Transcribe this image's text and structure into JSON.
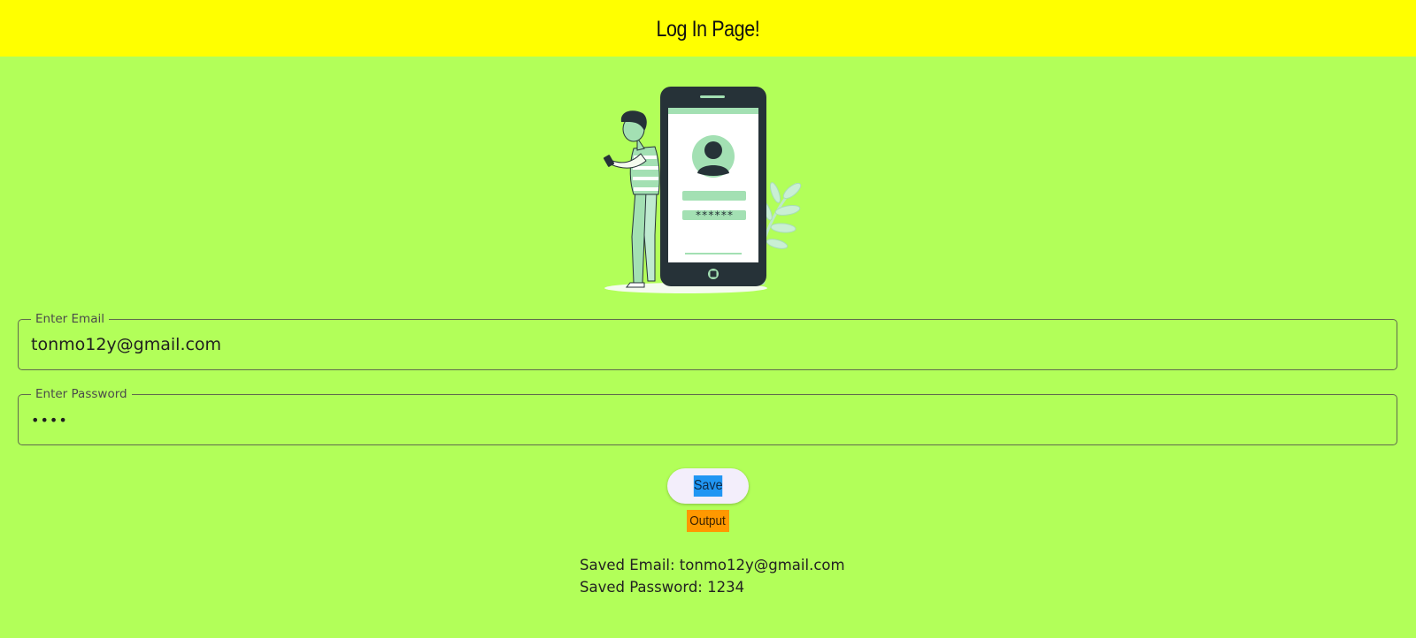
{
  "appbar": {
    "title": "Log In Page!",
    "background": "#ffff00"
  },
  "page": {
    "background": "#b2ff59"
  },
  "illustration": {
    "icon": "login-phone-illustration",
    "phone_password_mask": "******"
  },
  "form": {
    "email": {
      "label": "Enter Email",
      "value": "tonmo12y@gmail.com"
    },
    "password": {
      "label": "Enter Password",
      "value": "1234",
      "masked_value": "••••"
    }
  },
  "actions": {
    "save_label": "Save",
    "save_highlight": "#2196f3",
    "output_label": "Output",
    "output_color": "#ff9800"
  },
  "saved": {
    "email_line": "Saved Email: tonmo12y@gmail.com",
    "password_line": "Saved Password: 1234"
  }
}
